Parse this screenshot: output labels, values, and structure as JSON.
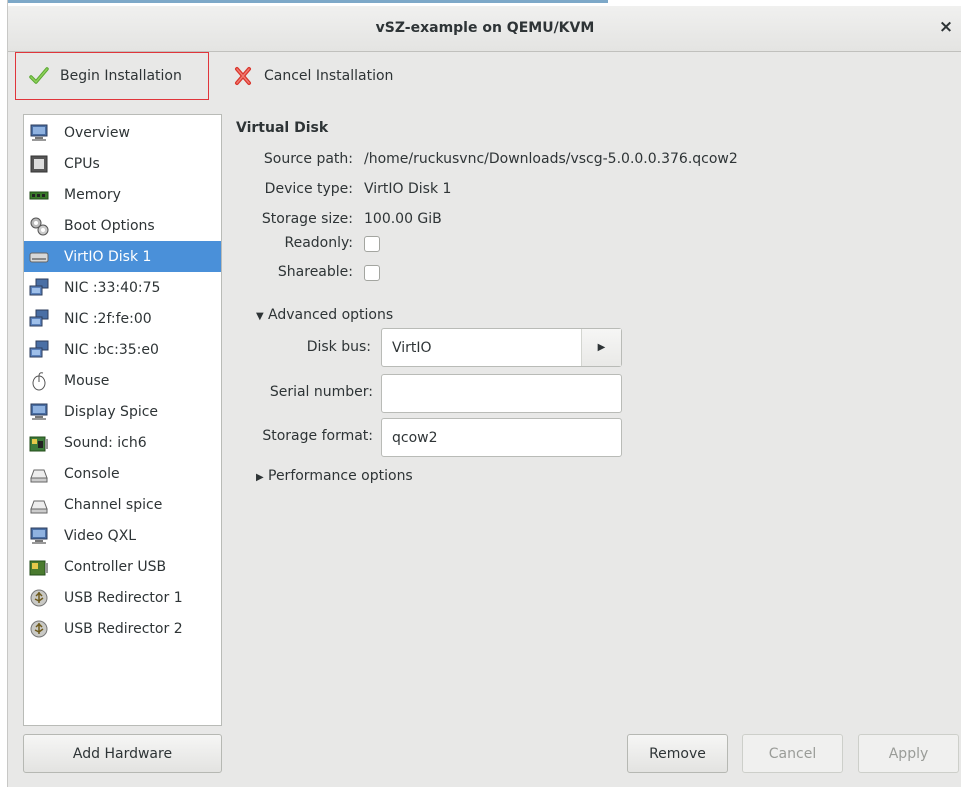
{
  "window": {
    "title": "vSZ-example on QEMU/KVM",
    "close_glyph": "×"
  },
  "toolbar": {
    "begin_label": "Begin Installation",
    "begin_icon": "checkmark-icon",
    "cancel_label": "Cancel Installation",
    "cancel_icon": "red-x-icon"
  },
  "sidebar": {
    "items": [
      {
        "label": "Overview",
        "icon": "monitor-icon"
      },
      {
        "label": "CPUs",
        "icon": "cpu-icon"
      },
      {
        "label": "Memory",
        "icon": "memory-icon"
      },
      {
        "label": "Boot Options",
        "icon": "gears-icon"
      },
      {
        "label": "VirtIO Disk 1",
        "icon": "disk-icon",
        "selected": true
      },
      {
        "label": "NIC :33:40:75",
        "icon": "network-icon"
      },
      {
        "label": "NIC :2f:fe:00",
        "icon": "network-icon"
      },
      {
        "label": "NIC :bc:35:e0",
        "icon": "network-icon"
      },
      {
        "label": "Mouse",
        "icon": "mouse-icon"
      },
      {
        "label": "Display Spice",
        "icon": "display-icon"
      },
      {
        "label": "Sound: ich6",
        "icon": "sound-card-icon"
      },
      {
        "label": "Console",
        "icon": "serial-icon"
      },
      {
        "label": "Channel spice",
        "icon": "serial-icon"
      },
      {
        "label": "Video QXL",
        "icon": "display-icon"
      },
      {
        "label": "Controller USB",
        "icon": "controller-icon"
      },
      {
        "label": "USB Redirector 1",
        "icon": "usb-icon"
      },
      {
        "label": "USB Redirector 2",
        "icon": "usb-icon"
      }
    ],
    "add_hardware_label": "Add Hardware"
  },
  "details": {
    "section_title": "Virtual Disk",
    "source_path_label": "Source path:",
    "source_path_value": "/home/ruckusvnc/Downloads/vscg-5.0.0.0.376.qcow2",
    "device_type_label": "Device type:",
    "device_type_value": "VirtIO Disk 1",
    "storage_size_label": "Storage size:",
    "storage_size_value": "100.00 GiB",
    "readonly_label": "Readonly:",
    "readonly_checked": false,
    "shareable_label": "Shareable:",
    "shareable_checked": false,
    "advanced_label": "Advanced options",
    "disk_bus_label": "Disk bus:",
    "disk_bus_value": "VirtIO",
    "serial_label": "Serial number:",
    "serial_value": "",
    "storage_format_label": "Storage format:",
    "storage_format_value": "qcow2",
    "performance_label": "Performance options"
  },
  "footer": {
    "remove_label": "Remove",
    "cancel_label": "Cancel",
    "apply_label": "Apply"
  },
  "colors": {
    "selection": "#4a90d9",
    "highlight_border": "#e0353b"
  }
}
